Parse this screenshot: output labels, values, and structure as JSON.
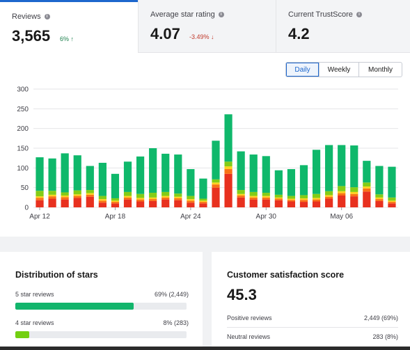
{
  "tabs": [
    {
      "label": "Reviews",
      "value": "3,565",
      "change": "6% ↑",
      "direction": "up",
      "active": true
    },
    {
      "label": "Average star rating",
      "value": "4.07",
      "change": "-3.49% ↓",
      "direction": "down",
      "active": false
    },
    {
      "label": "Current TrustScore",
      "value": "4.2",
      "change": "",
      "direction": "",
      "active": false
    }
  ],
  "period_toggle": {
    "options": [
      "Daily",
      "Weekly",
      "Monthly"
    ],
    "selected": "Daily"
  },
  "chart_data": {
    "type": "bar",
    "stacked": true,
    "categories": [
      "Apr 12",
      "Apr 13",
      "Apr 14",
      "Apr 15",
      "Apr 16",
      "Apr 17",
      "Apr 18",
      "Apr 19",
      "Apr 20",
      "Apr 21",
      "Apr 22",
      "Apr 23",
      "Apr 24",
      "Apr 25",
      "Apr 26",
      "Apr 27",
      "Apr 28",
      "Apr 29",
      "Apr 30",
      "May 01",
      "May 02",
      "May 03",
      "May 04",
      "May 05",
      "May 06",
      "May 07",
      "May 08",
      "May 09"
    ],
    "x_tick_labels": [
      "Apr 12",
      "Apr 18",
      "Apr 24",
      "Apr 30",
      "May 06"
    ],
    "ylim": [
      0,
      300
    ],
    "y_ticks": [
      0,
      50,
      100,
      150,
      200,
      250,
      300
    ],
    "grid": true,
    "series": [
      {
        "color": "#e8311f",
        "values": [
          18,
          22,
          20,
          24,
          27,
          12,
          10,
          20,
          15,
          16,
          20,
          18,
          12,
          10,
          50,
          85,
          25,
          20,
          20,
          18,
          15,
          14,
          15,
          22,
          30,
          28,
          40,
          16,
          10
        ]
      },
      {
        "color": "#f97316",
        "values": [
          6,
          6,
          6,
          5,
          5,
          5,
          4,
          5,
          5,
          5,
          5,
          5,
          5,
          4,
          8,
          12,
          5,
          5,
          5,
          4,
          4,
          5,
          5,
          5,
          6,
          6,
          8,
          5,
          4
        ]
      },
      {
        "color": "#ffd21f",
        "values": [
          4,
          4,
          4,
          4,
          4,
          4,
          3,
          4,
          4,
          4,
          4,
          4,
          4,
          3,
          5,
          7,
          4,
          4,
          4,
          3,
          3,
          4,
          4,
          4,
          5,
          5,
          5,
          4,
          3
        ]
      },
      {
        "color": "#84cc16",
        "values": [
          14,
          10,
          8,
          10,
          8,
          8,
          6,
          10,
          10,
          12,
          10,
          8,
          8,
          5,
          8,
          12,
          10,
          10,
          8,
          7,
          7,
          8,
          10,
          10,
          13,
          12,
          10,
          8,
          8
        ]
      },
      {
        "color": "#0fb86b",
        "values": [
          85,
          82,
          99,
          89,
          61,
          84,
          62,
          77,
          95,
          113,
          97,
          99,
          68,
          51,
          98,
          120,
          98,
          95,
          93,
          62,
          68,
          76,
          112,
          117,
          104,
          106,
          55,
          72,
          78
        ]
      }
    ]
  },
  "distribution": {
    "title": "Distribution of stars",
    "rows": [
      {
        "label": "5 star reviews",
        "value": "69% (2,449)",
        "fraction": 0.69,
        "color": "#13b56c"
      },
      {
        "label": "4 star reviews",
        "value": "8% (283)",
        "fraction": 0.08,
        "color": "#73cf11"
      }
    ]
  },
  "csat": {
    "title": "Customer satisfaction score",
    "score": "45.3",
    "rows": [
      {
        "label": "Positive reviews",
        "value": "2,449 (69%)"
      },
      {
        "label": "Neutral reviews",
        "value": "283 (8%)"
      }
    ]
  }
}
